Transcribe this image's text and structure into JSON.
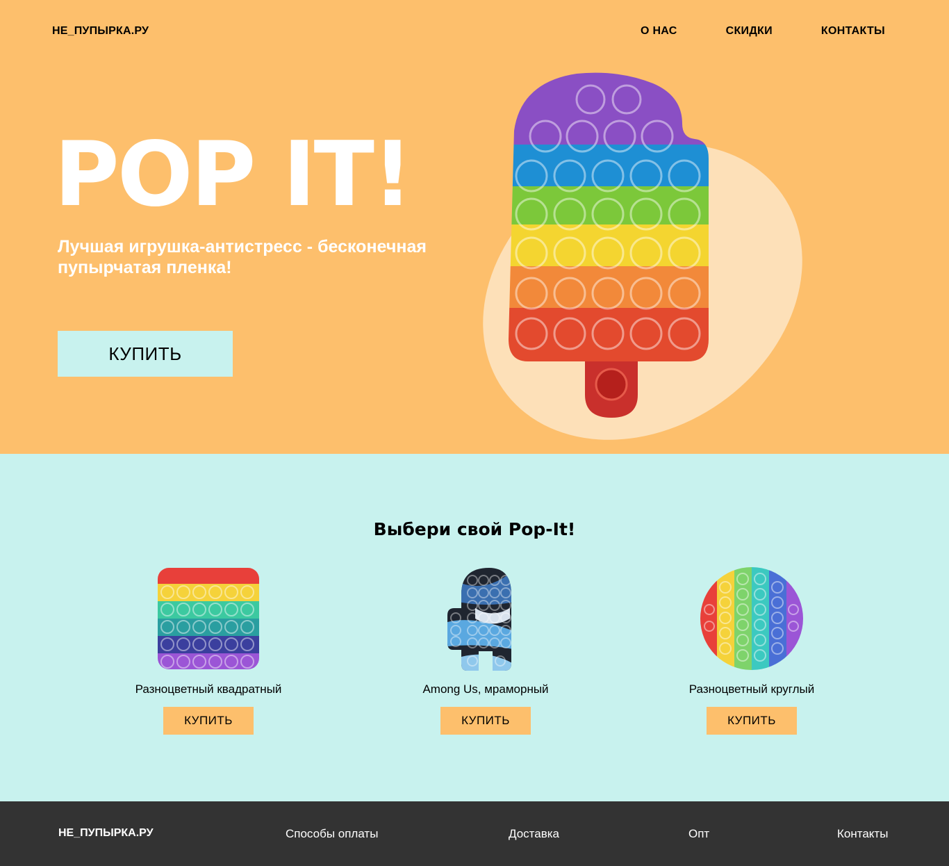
{
  "header": {
    "logo": "НЕ_ПУПЫРКА.РУ",
    "nav": [
      "О НАС",
      "СКИДКИ",
      "КОНТАКТЫ"
    ]
  },
  "hero": {
    "title": "POP IT!",
    "subtitle": "Лучшая игрушка-антистресс - бесконечная пупырчатая пленка!",
    "buy_label": "КУПИТЬ"
  },
  "catalog": {
    "title": "Выбери свой Pop-It!",
    "products": [
      {
        "name": "Разноцветный квадратный",
        "buy_label": "КУПИТЬ"
      },
      {
        "name": "Among Us, мраморный",
        "buy_label": "КУПИТЬ"
      },
      {
        "name": "Разноцветный круглый",
        "buy_label": "КУПИТЬ"
      }
    ]
  },
  "footer": {
    "logo": "НЕ_ПУПЫРКА.РУ",
    "links": [
      "Способы оплаты",
      "Доставка",
      "Опт",
      "Контакты"
    ]
  },
  "colors": {
    "hero_bg": "#fdbf6c",
    "catalog_bg": "#c8f2ee",
    "footer_bg": "#333333",
    "accent_button": "#c8f2ee",
    "product_button": "#fdbf6c"
  }
}
